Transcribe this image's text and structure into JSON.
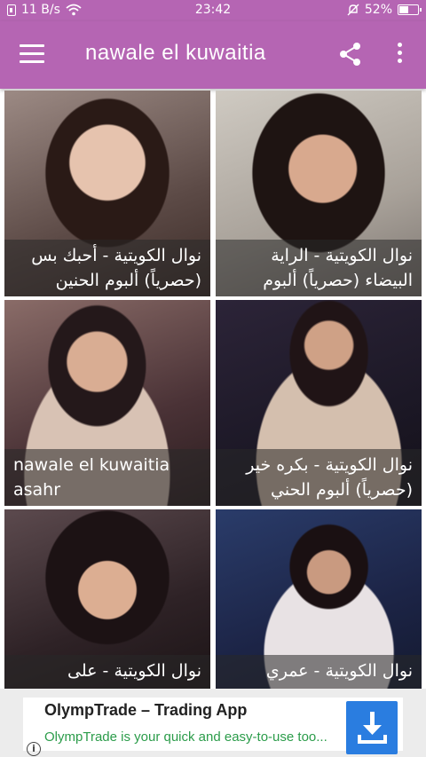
{
  "status_bar": {
    "speed": "11 B/s",
    "time": "23:42",
    "battery": "52%",
    "battery_level": 0.52
  },
  "app_bar": {
    "title": "nawale el kuwaitia",
    "menu_icon": "hamburger-menu-icon",
    "share_icon": "share-icon",
    "more_icon": "more-vert-icon"
  },
  "colors": {
    "primary": "#b565b3",
    "ad_text": "#2b9c4a",
    "ad_button": "#2a7de0"
  },
  "items": [
    {
      "caption": "نوال الكويتية - أحبك بس (حصرياً) ألبوم الحنين",
      "dir": "rtl"
    },
    {
      "caption": "نوال الكويتية - الراية البيضاء (حصرياً) ألبوم",
      "dir": "rtl"
    },
    {
      "caption": "nawale el kuwaitia asahr",
      "dir": "ltr"
    },
    {
      "caption": "نوال الكويتية - بكره خير (حصرياً) ألبوم الحني",
      "dir": "rtl"
    },
    {
      "caption": "نوال الكويتية - على",
      "dir": "rtl"
    },
    {
      "caption": "نوال الكويتية - عمري",
      "dir": "rtl"
    }
  ],
  "ad": {
    "title": "OlympTrade – Trading App",
    "description": "OlympTrade is your quick and easy-to-use too...",
    "download_icon": "download-icon",
    "info_icon": "info-icon"
  }
}
